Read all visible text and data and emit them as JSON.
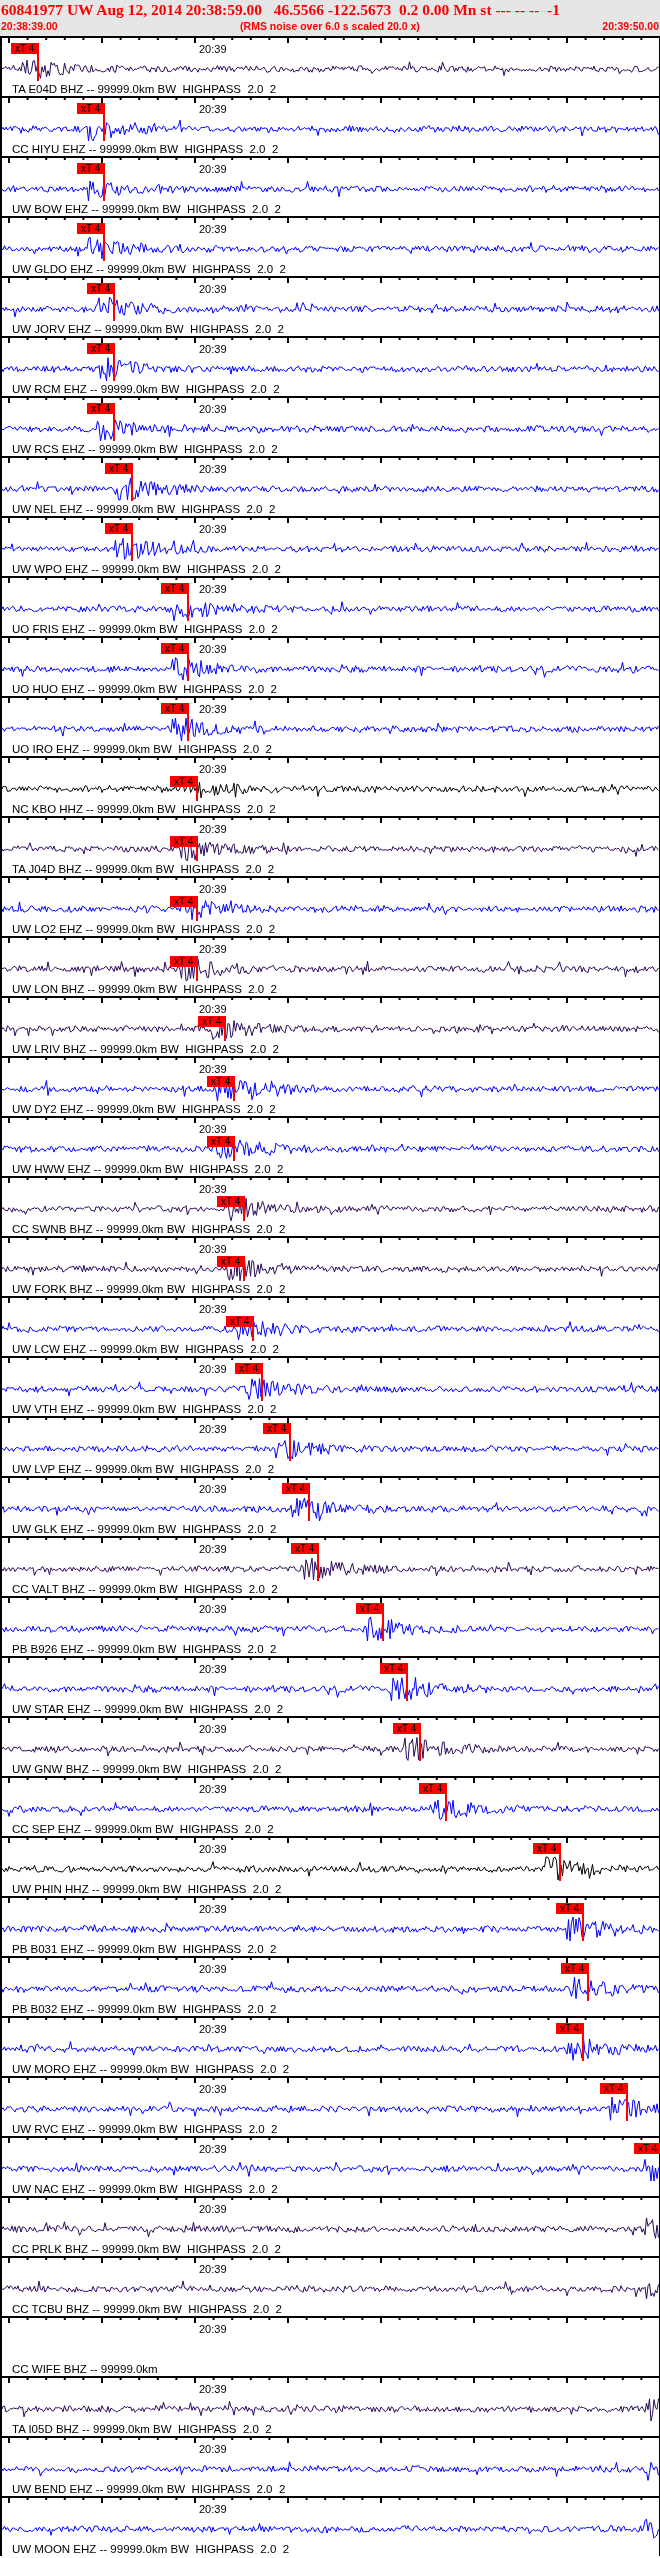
{
  "header": {
    "title": "60841977 UW Aug 12, 2014 20:38:59.00   46.5566 -122.5673  0.2 0.00 Mn st --- -- --  -1",
    "start_time": "20:38:39.00",
    "note": "(RMS noise over 6.0 s scaled 20.0 x)",
    "end_time": "20:39:50.00"
  },
  "stations": [
    {
      "label": "TA E04D BHZ -- 99999.0km BW  HIGHPASS  2.0  2",
      "time_label": "20:39",
      "color": "#2a0a5a",
      "pick": "xT 4"
    },
    {
      "label": "CC HIYU EHZ -- 99999.0km BW  HIGHPASS  2.0  2",
      "time_label": "20:39",
      "color": "#0000ff",
      "pick": "xT 4"
    },
    {
      "label": "UW BOW EHZ -- 99999.0km BW  HIGHPASS  2.0  2",
      "time_label": "20:39",
      "color": "#0000ff",
      "pick": "xT 4"
    },
    {
      "label": "UW GLDO EHZ -- 99999.0km BW  HIGHPASS  2.0  2",
      "time_label": "20:39",
      "color": "#0000ff",
      "pick": "xT 4"
    },
    {
      "label": "UW JORV EHZ -- 99999.0km BW  HIGHPASS  2.0  2",
      "time_label": "20:39",
      "color": "#0000ff",
      "pick": "xT 4"
    },
    {
      "label": "UW RCM EHZ -- 99999.0km BW  HIGHPASS  2.0  2",
      "time_label": "20:39",
      "color": "#0000ff",
      "pick": "xT 4"
    },
    {
      "label": "UW RCS EHZ -- 99999.0km BW  HIGHPASS  2.0  2",
      "time_label": "20:39",
      "color": "#0000ff",
      "pick": "xT 4"
    },
    {
      "label": "UW NEL EHZ -- 99999.0km BW  HIGHPASS  2.0  2",
      "time_label": "20:39",
      "color": "#0000ff",
      "pick": "xT 4"
    },
    {
      "label": "UW WPO EHZ -- 99999.0km BW  HIGHPASS  2.0  2",
      "time_label": "20:39",
      "color": "#0000ff",
      "pick": "xT 4"
    },
    {
      "label": "UO FRIS EHZ -- 99999.0km BW  HIGHPASS  2.0  2",
      "time_label": "20:39",
      "color": "#0000ff",
      "pick": "xT 4"
    },
    {
      "label": "UO HUO EHZ -- 99999.0km BW  HIGHPASS  2.0  2",
      "time_label": "20:39",
      "color": "#0000ff",
      "pick": "xT 4"
    },
    {
      "label": "UO IRO EHZ -- 99999.0km BW  HIGHPASS  2.0  2",
      "time_label": "20:39",
      "color": "#0000ff",
      "pick": "xT 4"
    },
    {
      "label": "NC KBO HHZ -- 99999.0km BW  HIGHPASS  2.0  2",
      "time_label": "20:39",
      "color": "#000000",
      "pick": "xT 4"
    },
    {
      "label": "TA J04D BHZ -- 99999.0km BW  HIGHPASS  2.0  2",
      "time_label": "20:39",
      "color": "#2a0a5a",
      "pick": "xT 4"
    },
    {
      "label": "UW LO2 EHZ -- 99999.0km BW  HIGHPASS  2.0  2",
      "time_label": "20:39",
      "color": "#0000ff",
      "pick": "xT 4"
    },
    {
      "label": "UW LON BHZ -- 99999.0km BW  HIGHPASS  2.0  2",
      "time_label": "20:39",
      "color": "#2a0a5a",
      "pick": "xT 4"
    },
    {
      "label": "UW LRIV BHZ -- 99999.0km BW  HIGHPASS  2.0  2",
      "time_label": "20:39",
      "color": "#2a0a5a",
      "pick": "xT 4"
    },
    {
      "label": "UW DY2 EHZ -- 99999.0km BW  HIGHPASS  2.0  2",
      "time_label": "20:39",
      "color": "#0000ff",
      "pick": "xT 4"
    },
    {
      "label": "UW HWW EHZ -- 99999.0km BW  HIGHPASS  2.0  2",
      "time_label": "20:39",
      "color": "#0000ff",
      "pick": "xT 4"
    },
    {
      "label": "CC SWNB BHZ -- 99999.0km BW  HIGHPASS  2.0  2",
      "time_label": "20:39",
      "color": "#2a0a5a",
      "pick": "xT 4"
    },
    {
      "label": "UW FORK BHZ -- 99999.0km BW  HIGHPASS  2.0  2",
      "time_label": "20:39",
      "color": "#2a0a5a",
      "pick": "xT 4"
    },
    {
      "label": "UW LCW EHZ -- 99999.0km BW  HIGHPASS  2.0  2",
      "time_label": "20:39",
      "color": "#0000ff",
      "pick": "xT 4"
    },
    {
      "label": "UW VTH EHZ -- 99999.0km BW  HIGHPASS  2.0  2",
      "time_label": "20:39",
      "color": "#0000ff",
      "pick": "xT 4"
    },
    {
      "label": "UW LVP EHZ -- 99999.0km BW  HIGHPASS  2.0  2",
      "time_label": "20:39",
      "color": "#0000ff",
      "pick": "xT 4"
    },
    {
      "label": "UW GLK EHZ -- 99999.0km BW  HIGHPASS  2.0  2",
      "time_label": "20:39",
      "color": "#0000ff",
      "pick": "xT 4"
    },
    {
      "label": "CC VALT BHZ -- 99999.0km BW  HIGHPASS  2.0  2",
      "time_label": "20:39",
      "color": "#2a0a5a",
      "pick": "xT 4"
    },
    {
      "label": "PB B926 EHZ -- 99999.0km BW  HIGHPASS  2.0  2",
      "time_label": "20:39",
      "color": "#0000ff",
      "pick": "xT 4"
    },
    {
      "label": "UW STAR EHZ -- 99999.0km BW  HIGHPASS  2.0  2",
      "time_label": "20:39",
      "color": "#0000ff",
      "pick": "xT 4"
    },
    {
      "label": "UW GNW BHZ -- 99999.0km BW  HIGHPASS  2.0  2",
      "time_label": "20:39",
      "color": "#2a0a5a",
      "pick": "xT 4"
    },
    {
      "label": "CC SEP EHZ -- 99999.0km BW  HIGHPASS  2.0  2",
      "time_label": "20:39",
      "color": "#0000ff",
      "pick": "xT 4"
    },
    {
      "label": "UW PHIN HHZ -- 99999.0km BW  HIGHPASS  2.0  2",
      "time_label": "20:39",
      "color": "#000000",
      "pick": "xT 4"
    },
    {
      "label": "PB B031 EHZ -- 99999.0km BW  HIGHPASS  2.0  2",
      "time_label": "20:39",
      "color": "#0000ff",
      "pick": "xT 4"
    },
    {
      "label": "PB B032 EHZ -- 99999.0km BW  HIGHPASS  2.0  2",
      "time_label": "20:39",
      "color": "#0000ff",
      "pick": "xT 4"
    },
    {
      "label": "UW MORO EHZ -- 99999.0km BW  HIGHPASS  2.0  2",
      "time_label": "20:39",
      "color": "#0000ff",
      "pick": "xT 4"
    },
    {
      "label": "UW RVC EHZ -- 99999.0km BW  HIGHPASS  2.0  2",
      "time_label": "20:39",
      "color": "#0000ff",
      "pick": "xT 4"
    },
    {
      "label": "UW NAC EHZ -- 99999.0km BW  HIGHPASS  2.0  2",
      "time_label": "20:39",
      "color": "#0000ff",
      "pick": "xT 4"
    },
    {
      "label": "CC PRLK BHZ -- 99999.0km BW  HIGHPASS  2.0  2",
      "time_label": "20:39",
      "color": "#2a0a5a"
    },
    {
      "label": "CC TCBU BHZ -- 99999.0km BW  HIGHPASS  2.0  2",
      "time_label": "20:39",
      "color": "#2a0a5a"
    },
    {
      "label": "CC WIFE BHZ -- 99999.0km",
      "time_label": "20:39"
    },
    {
      "label": "TA I05D BHZ -- 99999.0km BW  HIGHPASS  2.0  2",
      "time_label": "20:39",
      "color": "#2a0a5a"
    },
    {
      "label": "UW BEND EHZ -- 99999.0km BW  HIGHPASS  2.0  2",
      "time_label": "20:39",
      "color": "#0000ff"
    },
    {
      "label": "UW MOON EHZ -- 99999.0km BW  HIGHPASS  2.0  2",
      "time_label": "20:39",
      "color": "#0000ff"
    }
  ]
}
